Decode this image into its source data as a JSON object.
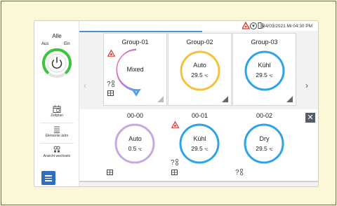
{
  "status": {
    "datetime": "24/03/2021 Mi 04:30 PM"
  },
  "sidebar": {
    "all_label": "Alle",
    "off_label": "Aus",
    "on_label": "Ein",
    "buttons": [
      {
        "label": "Zeitplan",
        "icon": "calendar-icon"
      },
      {
        "label": "Elemente ädrn",
        "icon": "edit-list-icon"
      },
      {
        "label": "Ansicht wechseln",
        "icon": "switch-view-icon"
      }
    ],
    "menu_icon": "hamburger-icon"
  },
  "groups": [
    {
      "name": "Group-01",
      "mode": "Mixed",
      "temp": "",
      "ring": "gradient"
    },
    {
      "name": "Group-02",
      "mode": "Auto",
      "temp": "29.5",
      "ring": "#f5c23e"
    },
    {
      "name": "Group-03",
      "mode": "Kühl",
      "temp": "29.5",
      "ring": "#2ea4e8"
    }
  ],
  "units": [
    {
      "name": "00-00",
      "mode": "Auto",
      "temp": "0.5",
      "ring": "#c6a9de"
    },
    {
      "name": "00-01",
      "mode": "Kühl",
      "temp": "29.5",
      "ring": "#2ea4e8"
    },
    {
      "name": "00-02",
      "mode": "Dry",
      "temp": "29.5",
      "ring": "#2ea4e8"
    }
  ],
  "temp_unit": "℃",
  "colors": {
    "accent": "#4a90d9",
    "power_ring": "#3cc43c",
    "alert": "#e0322b"
  }
}
